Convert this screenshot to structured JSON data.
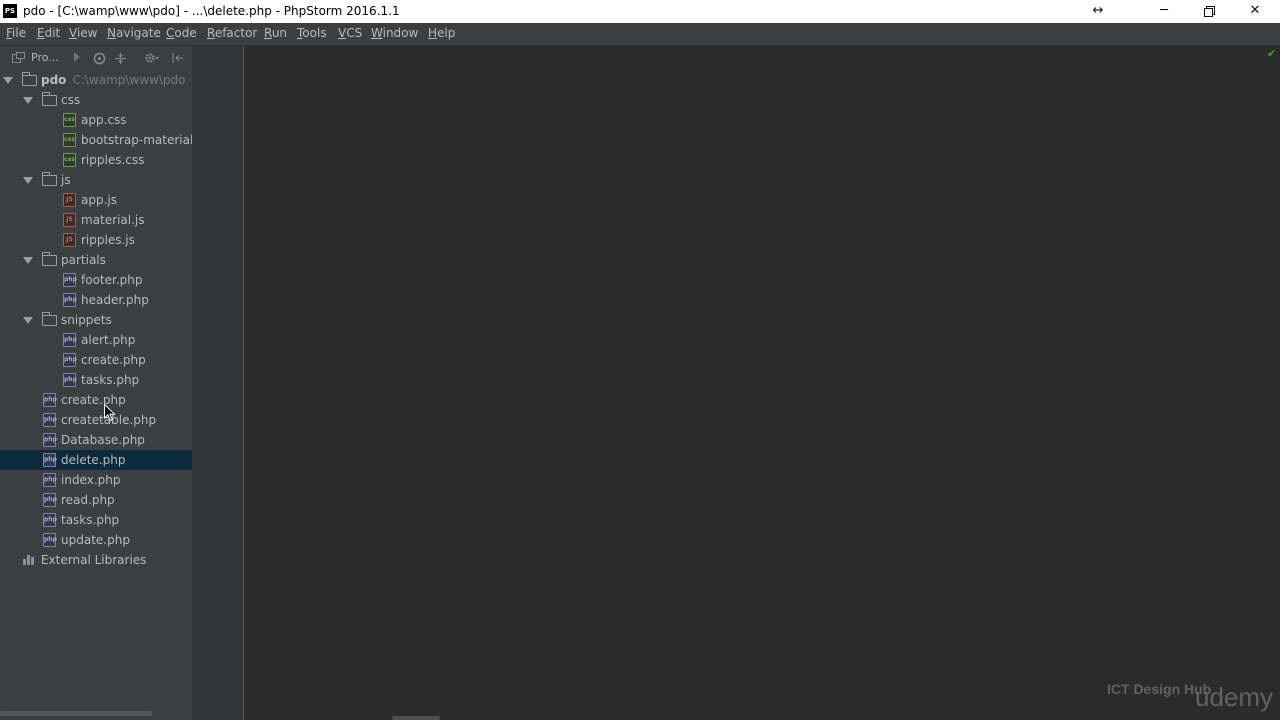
{
  "window": {
    "app_icon": "PS",
    "title": "pdo - [C:\\wamp\\www\\pdo] - ...\\delete.php - PhpStorm 2016.1.1",
    "controls": [
      "resize-icon",
      "minimize-icon",
      "maximize-icon",
      "close-icon"
    ]
  },
  "menu": [
    {
      "label": "File",
      "u": "F",
      "rest": "ile"
    },
    {
      "label": "Edit",
      "u": "E",
      "rest": "dit"
    },
    {
      "label": "View",
      "u": "V",
      "rest": "iew"
    },
    {
      "label": "Navigate",
      "u": "N",
      "rest": "avigate"
    },
    {
      "label": "Code",
      "u": "C",
      "rest": "ode"
    },
    {
      "label": "Refactor",
      "u": "R",
      "rest": "efactor"
    },
    {
      "label": "Run",
      "u": "R",
      "rest": "un"
    },
    {
      "label": "Tools",
      "u": "T",
      "rest": "ools"
    },
    {
      "label": "VCS",
      "u": "V",
      "rest": "CS"
    },
    {
      "label": "Window",
      "u": "W",
      "rest": "indow"
    },
    {
      "label": "Help",
      "u": "H",
      "rest": "elp"
    }
  ],
  "project_panel": {
    "label": "Pro...",
    "tree": [
      {
        "type": "root",
        "name": "pdo",
        "path": "C:\\wamp\\www\\pdo"
      },
      {
        "type": "folder",
        "name": "css"
      },
      {
        "type": "file",
        "kind": "css",
        "name": "app.css"
      },
      {
        "type": "file",
        "kind": "css",
        "name": "bootstrap-material-d"
      },
      {
        "type": "file",
        "kind": "css",
        "name": "ripples.css"
      },
      {
        "type": "folder",
        "name": "js"
      },
      {
        "type": "file",
        "kind": "js",
        "name": "app.js"
      },
      {
        "type": "file",
        "kind": "js",
        "name": "material.js"
      },
      {
        "type": "file",
        "kind": "js",
        "name": "ripples.js"
      },
      {
        "type": "folder",
        "name": "partials"
      },
      {
        "type": "file",
        "kind": "php",
        "name": "footer.php"
      },
      {
        "type": "file",
        "kind": "php",
        "name": "header.php"
      },
      {
        "type": "folder",
        "name": "snippets"
      },
      {
        "type": "file",
        "kind": "php",
        "name": "alert.php"
      },
      {
        "type": "file",
        "kind": "php",
        "name": "create.php"
      },
      {
        "type": "file",
        "kind": "php",
        "name": "tasks.php"
      },
      {
        "type": "rootfile",
        "kind": "php",
        "name": "create.php"
      },
      {
        "type": "rootfile",
        "kind": "php",
        "name": "createtable.php"
      },
      {
        "type": "rootfile",
        "kind": "php",
        "name": "Database.php"
      },
      {
        "type": "rootfile",
        "kind": "php",
        "name": "delete.php",
        "selected": true
      },
      {
        "type": "rootfile",
        "kind": "php",
        "name": "index.php"
      },
      {
        "type": "rootfile",
        "kind": "php",
        "name": "read.php"
      },
      {
        "type": "rootfile",
        "kind": "php",
        "name": "tasks.php"
      },
      {
        "type": "rootfile",
        "kind": "php",
        "name": "update.php"
      },
      {
        "type": "library",
        "name": "External Libraries"
      }
    ]
  },
  "watermark": {
    "brand": "ICT Design Hub",
    "platform": "udemy"
  },
  "colors": {
    "selection": "#0d293e",
    "panel": "#3c3f41",
    "editor": "#2b2b2b"
  }
}
